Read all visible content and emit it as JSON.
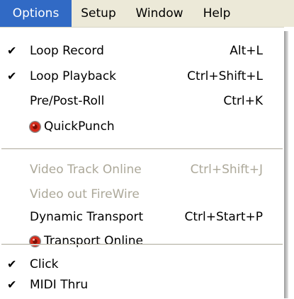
{
  "menubar": {
    "items": [
      {
        "label": "Options",
        "active": true
      },
      {
        "label": "Setup",
        "active": false
      },
      {
        "label": "Window",
        "active": false
      },
      {
        "label": "Help",
        "active": false
      }
    ]
  },
  "menu": {
    "groups": [
      {
        "items": [
          {
            "check": "✔",
            "label": "Loop Record",
            "shortcut": "Alt+L",
            "enabled": true,
            "checked": true,
            "icon": null
          },
          {
            "check": "✔",
            "label": "Loop Playback",
            "shortcut": "Ctrl+Shift+L",
            "enabled": true,
            "checked": true,
            "icon": null
          },
          {
            "check": "",
            "label": "Pre/Post-Roll",
            "shortcut": "Ctrl+K",
            "enabled": true,
            "checked": false,
            "icon": null
          },
          {
            "check": "",
            "label": "QuickPunch",
            "shortcut": "",
            "enabled": true,
            "checked": false,
            "icon": "record-icon"
          }
        ]
      },
      {
        "items": [
          {
            "check": "",
            "label": "Video Track Online",
            "shortcut": "Ctrl+Shift+J",
            "enabled": false,
            "checked": false,
            "icon": null
          },
          {
            "check": "",
            "label": "Video out FireWire",
            "shortcut": "",
            "enabled": false,
            "checked": false,
            "icon": null
          },
          {
            "check": "",
            "label": "Dynamic Transport",
            "shortcut": "Ctrl+Start+P",
            "enabled": true,
            "checked": false,
            "icon": null
          },
          {
            "check": "",
            "label": "Transport Online",
            "shortcut": "",
            "enabled": true,
            "checked": false,
            "icon": "record-icon"
          }
        ]
      },
      {
        "items": [
          {
            "check": "✔",
            "label": "Click",
            "shortcut": "",
            "enabled": true,
            "checked": true,
            "icon": null
          },
          {
            "check": "✔",
            "label": "MIDI Thru",
            "shortcut": "",
            "enabled": true,
            "checked": true,
            "icon": null
          }
        ]
      }
    ]
  },
  "colors": {
    "menubar_bg": "#ece9d8",
    "highlight": "#316ac5",
    "disabled_text": "#aca899",
    "icon_red": "#d42a1a"
  }
}
